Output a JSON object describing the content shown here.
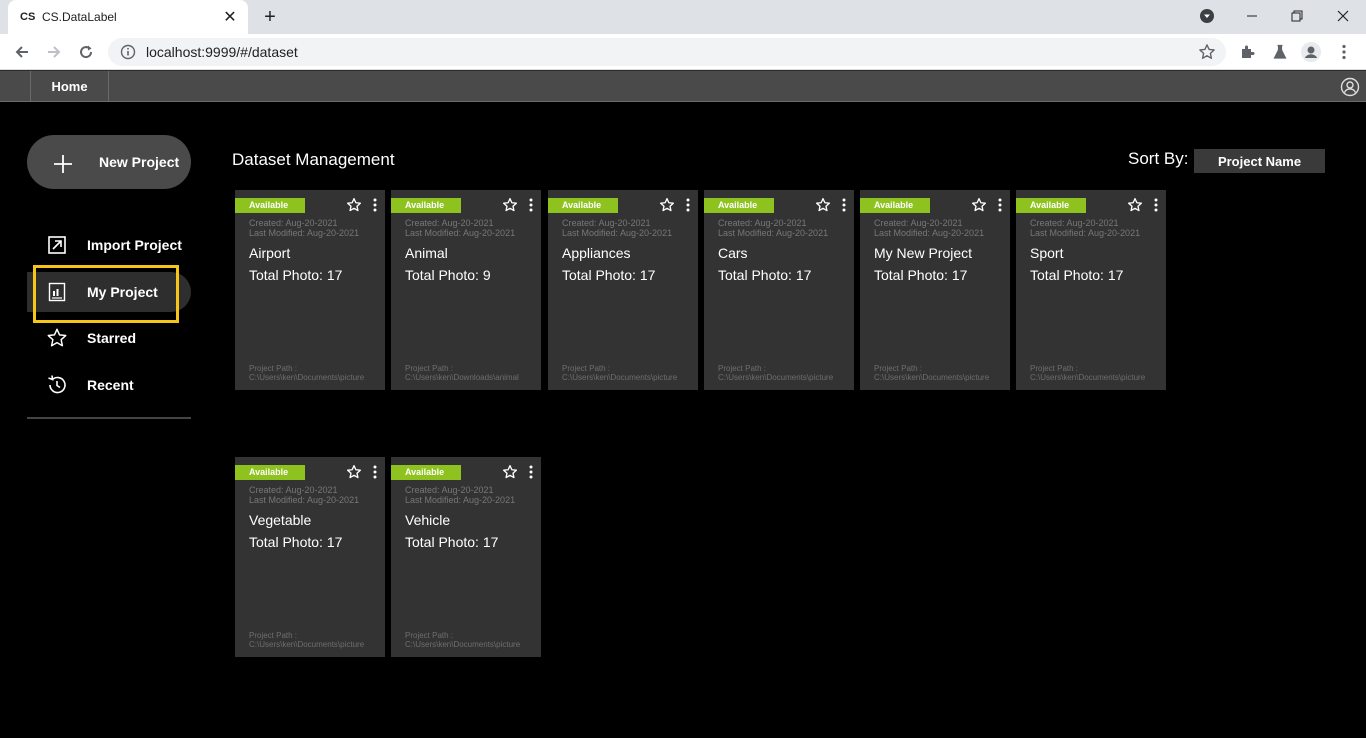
{
  "browser": {
    "tab_favicon": "CS",
    "tab_title": "CS.DataLabel",
    "tab_close": "✕",
    "new_tab": "+",
    "url": "localhost:9999/#/dataset"
  },
  "app": {
    "home_tab": "Home"
  },
  "sidebar": {
    "new_project": "New Project",
    "items": [
      {
        "label": "Import Project",
        "icon": "import-icon"
      },
      {
        "label": "My Project",
        "icon": "project-icon"
      },
      {
        "label": "Starred",
        "icon": "star-icon"
      },
      {
        "label": "Recent",
        "icon": "history-icon"
      }
    ]
  },
  "main": {
    "title": "Dataset Management",
    "sort_label": "Sort By:",
    "sort_value": "Project Name",
    "path_label": "Project Path :",
    "projects": [
      {
        "status": "Available",
        "created": "Created: Aug-20-2021",
        "modified": "Last Modified: Aug-20-2021",
        "name": "Airport",
        "photos": "Total Photo: 17",
        "path": "C:\\Users\\ken\\Documents\\picture"
      },
      {
        "status": "Available",
        "created": "Created: Aug-20-2021",
        "modified": "Last Modified: Aug-20-2021",
        "name": "Animal",
        "photos": "Total Photo: 9",
        "path": "C:\\Users\\ken\\Downloads\\animal"
      },
      {
        "status": "Available",
        "created": "Created: Aug-20-2021",
        "modified": "Last Modified: Aug-20-2021",
        "name": "Appliances",
        "photos": "Total Photo: 17",
        "path": "C:\\Users\\ken\\Documents\\picture"
      },
      {
        "status": "Available",
        "created": "Created: Aug-20-2021",
        "modified": "Last Modified: Aug-20-2021",
        "name": "Cars",
        "photos": "Total Photo: 17",
        "path": "C:\\Users\\ken\\Documents\\picture"
      },
      {
        "status": "Available",
        "created": "Created: Aug-20-2021",
        "modified": "Last Modified: Aug-20-2021",
        "name": "My New Project",
        "photos": "Total Photo: 17",
        "path": "C:\\Users\\ken\\Documents\\picture"
      },
      {
        "status": "Available",
        "created": "Created: Aug-20-2021",
        "modified": "Last Modified: Aug-20-2021",
        "name": "Sport",
        "photos": "Total Photo: 17",
        "path": "C:\\Users\\ken\\Documents\\picture"
      },
      {
        "status": "Available",
        "created": "Created: Aug-20-2021",
        "modified": "Last Modified: Aug-20-2021",
        "name": "Vegetable",
        "photos": "Total Photo: 17",
        "path": "C:\\Users\\ken\\Documents\\picture"
      },
      {
        "status": "Available",
        "created": "Created: Aug-20-2021",
        "modified": "Last Modified: Aug-20-2021",
        "name": "Vehicle",
        "photos": "Total Photo: 17",
        "path": "C:\\Users\\ken\\Documents\\picture"
      }
    ]
  },
  "colors": {
    "badge": "#8ec31f",
    "highlight": "#f5c518",
    "card_bg": "#333333"
  }
}
